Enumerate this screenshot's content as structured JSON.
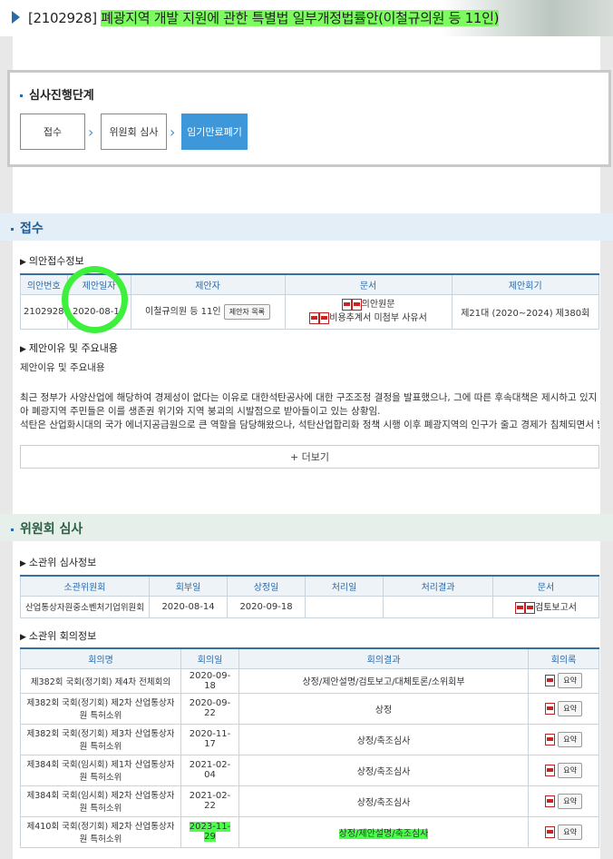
{
  "header": {
    "bill_no": "[2102928]",
    "bill_title": "폐광지역 개발 지원에 관한 특별법 일부개정법률안(이철규의원 등 11인)"
  },
  "stages": {
    "title": "심사진행단계",
    "steps": [
      "접수",
      "위원회 심사",
      "임기만료폐기"
    ]
  },
  "reception": {
    "title": "접수",
    "info_title": "의안접수정보",
    "columns": [
      "의안번호",
      "제안일자",
      "제안자",
      "문서",
      "제안회기"
    ],
    "row": {
      "bill_no": "2102928",
      "date": "2020-08-13",
      "proposer": "이철규의원 등 11인",
      "proposer_btn": "제안자 목록",
      "doc1": "의안원문",
      "doc2": "비용추계서 미첨부 사유서",
      "session": "제21대 (2020~2024) 제380회"
    },
    "reason_title": "제안이유 및 주요내용",
    "reason_sub": "제안이유 및 주요내용",
    "reason_lines": [
      "최근 정부가 사양산업에 해당하여 경제성이 없다는 이유로 대한석탄공사에 대한 구조조정 결정을 발표했으나, 그에 따른 후속대책은 제시하고 있지 않",
      "아 폐광지역 주민들은 이를 생존권 위기와 지역 붕괴의 시발점으로 받아들이고 있는 상황임.",
      "석탄은 산업화시대의 국가 에너지공급원으로 큰 역할을 담당해왔으나, 석탄산업합리화 정책 시행 이후 폐광지역의 인구가 줄고 경제가 침체되면서 발생"
    ],
    "more": "+ 더보기"
  },
  "committee": {
    "title": "위원회 심사",
    "info_title": "소관위 심사정보",
    "columns": [
      "소관위원회",
      "회부일",
      "상정일",
      "처리일",
      "처리결과",
      "문서"
    ],
    "row": {
      "committee": "산업통상자원중소벤처기업위원회",
      "refer_date": "2020-08-14",
      "present_date": "2020-09-18",
      "proc_date": "",
      "result": "",
      "doc": "검토보고서"
    },
    "meeting_title": "소관위 회의정보",
    "meeting_columns": [
      "회의명",
      "회의일",
      "회의결과",
      "회의록"
    ],
    "meetings": [
      {
        "name": "제382회 국회(정기회) 제4차 전체회의",
        "date": "2020-09-18",
        "result": "상정/제안설명/검토보고/대체토론/소위회부",
        "btn": "요약"
      },
      {
        "name": "제382회 국회(정기회) 제2차 산업통상자원 특허소위",
        "date": "2020-09-22",
        "result": "상정",
        "btn": "요약"
      },
      {
        "name": "제382회 국회(정기회) 제3차 산업통상자원 특허소위",
        "date": "2020-11-17",
        "result": "상정/축조심사",
        "btn": "요약"
      },
      {
        "name": "제384회 국회(임시회) 제1차 산업통상자원 특허소위",
        "date": "2021-02-04",
        "result": "상정/축조심사",
        "btn": "요약"
      },
      {
        "name": "제384회 국회(임시회) 제2차 산업통상자원 특허소위",
        "date": "2021-02-22",
        "result": "상정/축조심사",
        "btn": "요약"
      },
      {
        "name": "제410회 국회(정기회) 제2차 산업통상자원 특허소위",
        "date": "2023-11-29",
        "result": "상정/제안설명/축조심사",
        "btn": "요약"
      }
    ]
  }
}
